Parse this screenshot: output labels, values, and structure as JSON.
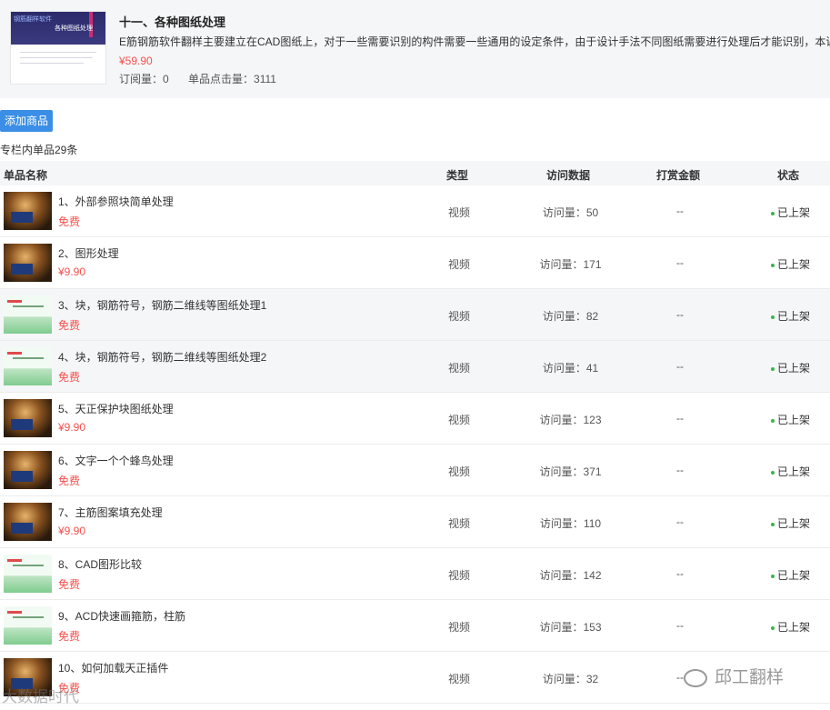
{
  "column": {
    "cover_text_1": "钢筋翻样软件",
    "cover_text_2": "各种图纸处理",
    "title": "十一、各种图纸处理",
    "description": "E筋钢筋软件翻样主要建立在CAD图纸上，对于一些需要识别的构件需要一些通用的设定条件，由于设计手法不同图纸需要进行处理后才能识别，本课",
    "price": "¥59.90",
    "subscriptions": "订阅量：0",
    "clicks": "单品点击量：3111"
  },
  "add_button_label": "添加商品",
  "count_text": "专栏内单品29条",
  "table": {
    "headers": {
      "name": "单品名称",
      "type": "类型",
      "visits": "访问数据",
      "reward": "打赏金额",
      "status": "状态"
    },
    "rows": [
      {
        "title": "1、外部参照块简单处理",
        "price": "免费",
        "type": "视频",
        "visits": "访问量：50",
        "reward": "--",
        "status": "已上架",
        "thumb": "dark"
      },
      {
        "title": "2、图形处理",
        "price": "¥9.90",
        "type": "视频",
        "visits": "访问量：171",
        "reward": "--",
        "status": "已上架",
        "thumb": "dark"
      },
      {
        "title": "3、块，钢筋符号，钢筋二维线等图纸处理1",
        "price": "免费",
        "type": "视频",
        "visits": "访问量：82",
        "reward": "--",
        "status": "已上架",
        "thumb": "green"
      },
      {
        "title": "4、块，钢筋符号，钢筋二维线等图纸处理2",
        "price": "免费",
        "type": "视频",
        "visits": "访问量：41",
        "reward": "--",
        "status": "已上架",
        "thumb": "green"
      },
      {
        "title": "5、天正保护块图纸处理",
        "price": "¥9.90",
        "type": "视频",
        "visits": "访问量：123",
        "reward": "--",
        "status": "已上架",
        "thumb": "dark"
      },
      {
        "title": "6、文字一个个蜂鸟处理",
        "price": "免费",
        "type": "视频",
        "visits": "访问量：371",
        "reward": "--",
        "status": "已上架",
        "thumb": "dark"
      },
      {
        "title": "7、主筋图案填充处理",
        "price": "¥9.90",
        "type": "视频",
        "visits": "访问量：110",
        "reward": "--",
        "status": "已上架",
        "thumb": "dark"
      },
      {
        "title": "8、CAD图形比较",
        "price": "免费",
        "type": "视频",
        "visits": "访问量：142",
        "reward": "--",
        "status": "已上架",
        "thumb": "green"
      },
      {
        "title": "9、ACD快速画箍筋，柱筋",
        "price": "免费",
        "type": "视频",
        "visits": "访问量：153",
        "reward": "--",
        "status": "已上架",
        "thumb": "green"
      },
      {
        "title": "10、如何加载天正插件",
        "price": "免费",
        "type": "视频",
        "visits": "访问量：32",
        "reward": "--",
        "status": "",
        "thumb": "dark"
      }
    ]
  },
  "watermarks": {
    "left": "大数据时代",
    "right": "邱工翻样"
  }
}
